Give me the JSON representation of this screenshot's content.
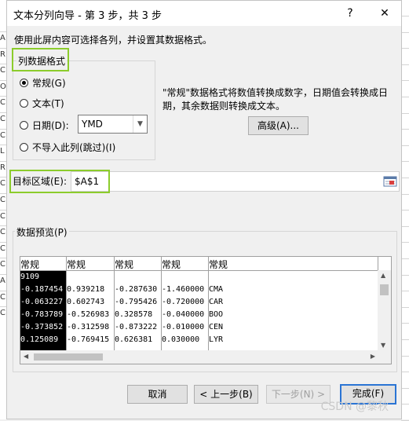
{
  "background_sheet": {
    "row_letters": [
      "A",
      "R",
      "C",
      "O",
      "C",
      "C",
      "C",
      "L",
      "R",
      "C",
      "C",
      "C",
      "C",
      "C",
      "C",
      "A",
      "C",
      "C"
    ]
  },
  "dialog": {
    "title": "文本分列向导 - 第 3 步，共 3 步",
    "help_symbol": "?",
    "close_symbol": "✕",
    "instruction": "使用此屏内容可选择各列，并设置其数据格式。",
    "highlight_color": "#8ccc2c"
  },
  "column_format": {
    "group_label": "列数据格式",
    "options": [
      {
        "label": "常规(G)",
        "checked": true
      },
      {
        "label": "文本(T)",
        "checked": false
      },
      {
        "label": "日期(D):",
        "checked": false
      },
      {
        "label": "不导入此列(跳过)(I)",
        "checked": false
      }
    ],
    "date_format": "YMD",
    "description": "\"常规\"数据格式将数值转换成数字，日期值会转换成日期，其余数据则转换成文本。",
    "advanced_button": "高级(A)..."
  },
  "destination": {
    "label": "目标区域(E):",
    "value": "$A$1",
    "collapse_icon": "range-select-icon"
  },
  "preview": {
    "group_label": "数据预览(P)",
    "headers": [
      "常规",
      "常规",
      "常规",
      "常规",
      "常规"
    ],
    "rows": [
      [
        "9109",
        "",
        "",
        "",
        ""
      ],
      [
        "-0.187454",
        "0.939218",
        "-0.287630",
        "-1.460000",
        "CMA"
      ],
      [
        "-0.063227",
        "0.602743",
        "-0.795426",
        "-0.720000",
        "CAR"
      ],
      [
        "-0.783789",
        "-0.526983",
        "0.328578",
        "-0.040000",
        "BOO"
      ],
      [
        "-0.373852",
        "-0.312598",
        "-0.873222",
        "-0.010000",
        "CEN"
      ],
      [
        "0.125089",
        "-0.769415",
        "0.626381",
        "0.030000",
        "LYR"
      ]
    ]
  },
  "buttons": {
    "cancel": "取消",
    "back": "< 上一步(B)",
    "next": "下一步(N) >",
    "finish": "完成(F)"
  },
  "watermark": "CSDN @黎秋"
}
